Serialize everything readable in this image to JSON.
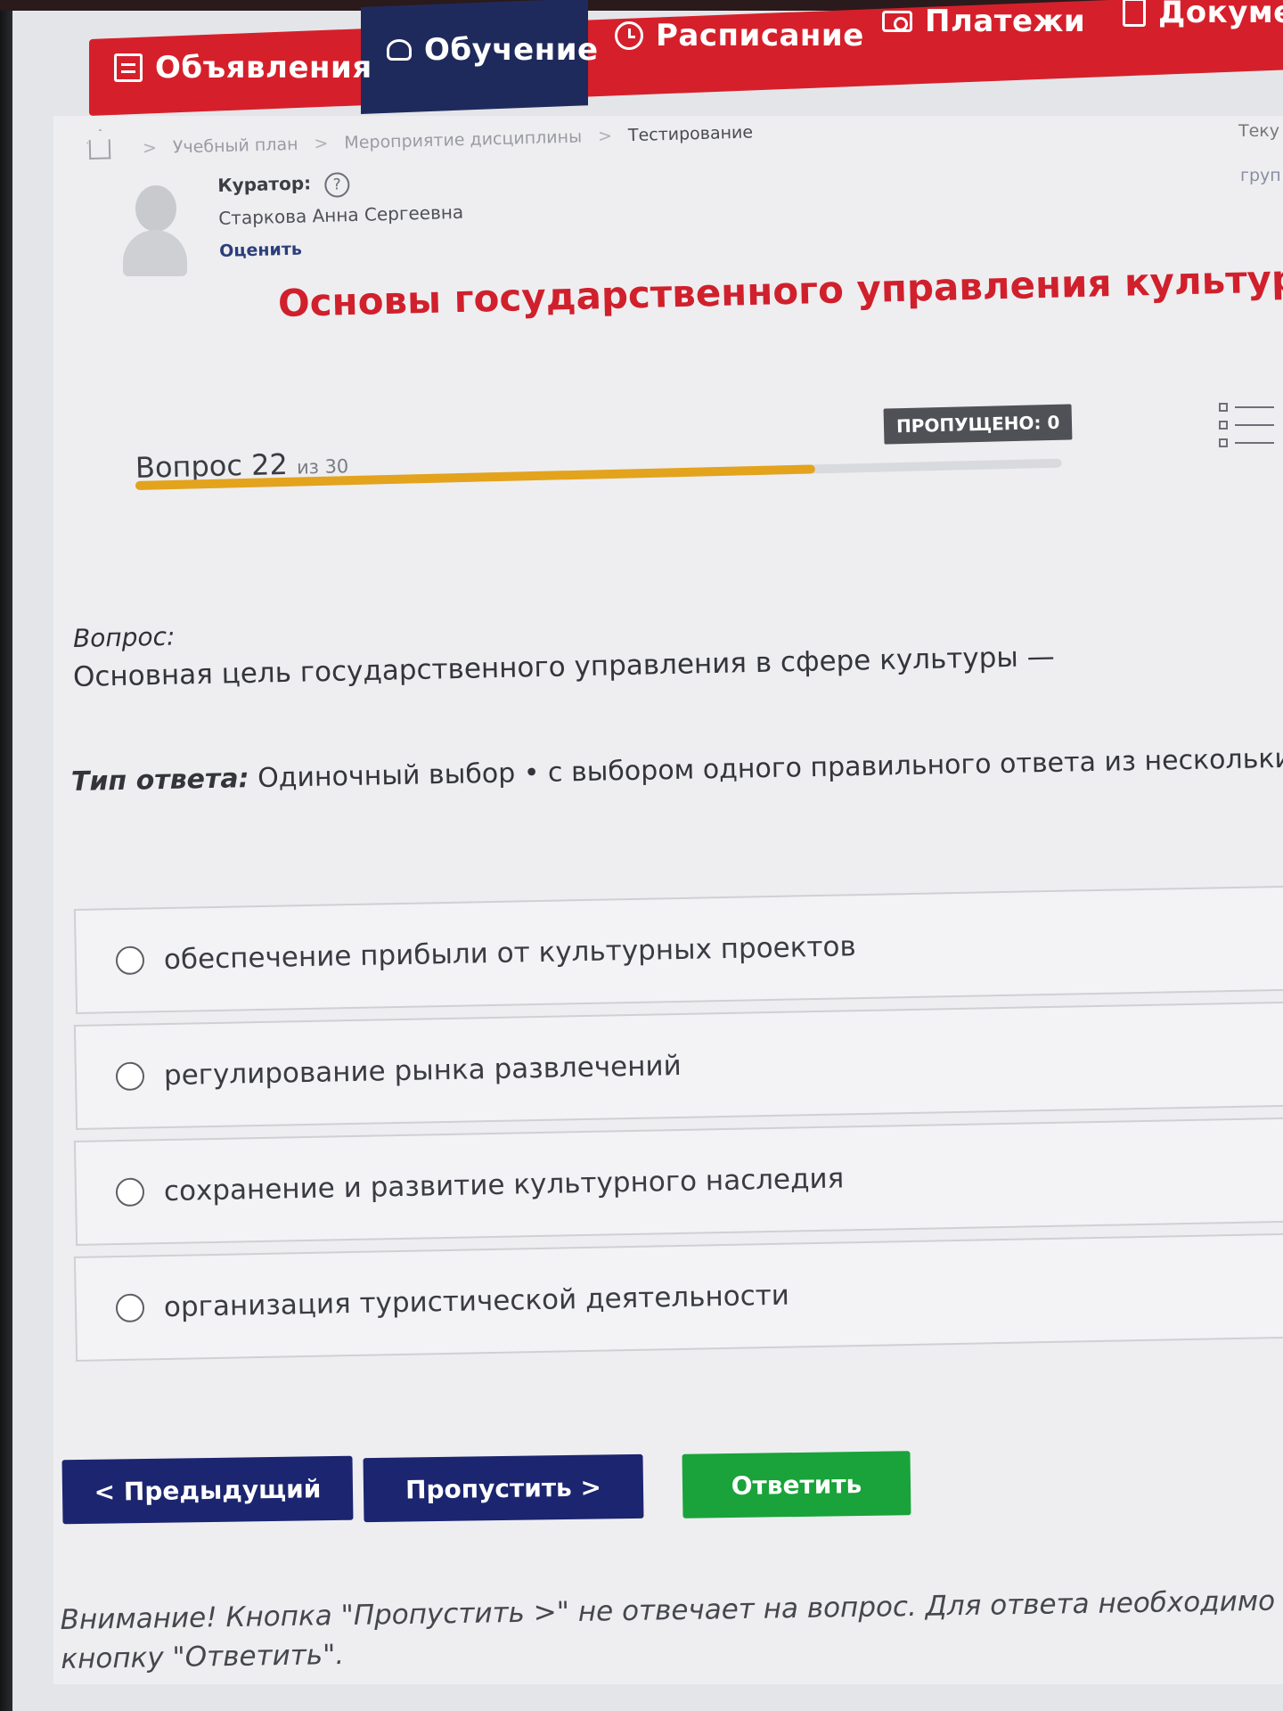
{
  "nav": {
    "items": [
      {
        "label": "Объявления",
        "icon": "newspaper-icon",
        "active": false
      },
      {
        "label": "Обучение",
        "icon": "graduation-cap-icon",
        "active": true
      },
      {
        "label": "Расписание",
        "icon": "clock-icon",
        "active": false
      },
      {
        "label": "Платежи",
        "icon": "money-icon",
        "active": false
      },
      {
        "label": "Докуме",
        "icon": "document-icon",
        "active": false
      }
    ],
    "colors": {
      "primary": "#d5202b",
      "active": "#1f2a5c"
    }
  },
  "breadcrumb": {
    "items": [
      "Учебный план",
      "Мероприятие дисциплины",
      "Тестирование"
    ],
    "separator": ">"
  },
  "right_edge": {
    "line1": "Теку",
    "line2": "груп"
  },
  "curator": {
    "label": "Куратор:",
    "help": "?",
    "name": "Старкова Анна Сергеевна",
    "rate_link": "Оценить"
  },
  "course": {
    "title": "Основы государственного управления культурой"
  },
  "progress": {
    "skipped_label": "ПРОПУЩЕНО: 0",
    "question_word": "Вопрос",
    "current": "22",
    "of_text": "из 30",
    "fraction": 0.7333,
    "color": "#e3a31c"
  },
  "question": {
    "label": "Вопрос:",
    "text": "Основная цель государственного управления в сфере культуры —",
    "answer_type_label": "Тип ответа:",
    "answer_type_value": "Одиночный выбор • с выбором одного правильного ответа из нескольких п"
  },
  "options": [
    "обеспечение прибыли от культурных проектов",
    "регулирование рынка развлечений",
    "сохранение и развитие культурного наследия",
    "организация туристической деятельности"
  ],
  "buttons": {
    "prev": "< Предыдущий",
    "skip": "Пропустить >",
    "answer": "Ответить",
    "colors": {
      "nav": "#1c2570",
      "answer": "#19a33a"
    }
  },
  "notice": {
    "line1": "Внимание! Кнопка \"Пропустить >\" не отвечает на вопрос. Для ответа необходимо",
    "line2": "кнопку \"Ответить\"."
  }
}
